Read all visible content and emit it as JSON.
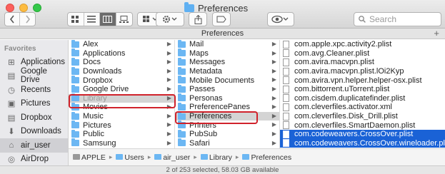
{
  "window": {
    "title": "Preferences",
    "path_title": "Preferences"
  },
  "toolbar": {
    "back_icon": "chevron-left-icon",
    "forward_icon": "chevron-right-icon",
    "view_modes": [
      "icon-view",
      "list-view",
      "column-view",
      "gallery-view"
    ],
    "active_view": "column-view",
    "search_placeholder": "Search"
  },
  "sidebar": {
    "heading": "Favorites",
    "items": [
      {
        "label": "Applications",
        "icon": "applications-icon"
      },
      {
        "label": "Google Drive",
        "icon": "drive-icon"
      },
      {
        "label": "Recents",
        "icon": "recents-icon"
      },
      {
        "label": "Pictures",
        "icon": "pictures-icon"
      },
      {
        "label": "Dropbox",
        "icon": "dropbox-icon"
      },
      {
        "label": "Downloads",
        "icon": "downloads-icon"
      },
      {
        "label": "air_user",
        "icon": "home-icon",
        "selected": true
      },
      {
        "label": "AirDrop",
        "icon": "airdrop-icon"
      }
    ]
  },
  "column1": [
    {
      "label": "Alex"
    },
    {
      "label": "Applications"
    },
    {
      "label": "Docs"
    },
    {
      "label": "Downloads"
    },
    {
      "label": "Dropbox"
    },
    {
      "label": "Google Drive"
    },
    {
      "label": "Library",
      "selected": true
    },
    {
      "label": "Movies"
    },
    {
      "label": "Music"
    },
    {
      "label": "Pictures"
    },
    {
      "label": "Public"
    },
    {
      "label": "Samsung"
    }
  ],
  "column2": [
    {
      "label": "Mail"
    },
    {
      "label": "Maps"
    },
    {
      "label": "Messages"
    },
    {
      "label": "Metadata"
    },
    {
      "label": "Mobile Documents"
    },
    {
      "label": "Passes"
    },
    {
      "label": "Personas"
    },
    {
      "label": "PreferencePanes"
    },
    {
      "label": "Preferences",
      "selected": true
    },
    {
      "label": "Printers"
    },
    {
      "label": "PubSub"
    },
    {
      "label": "Safari"
    }
  ],
  "column3": [
    {
      "label": "com.apple.xpc.activity2.plist"
    },
    {
      "label": "com.avg.Cleaner.plist"
    },
    {
      "label": "com.avira.macvpn.plist"
    },
    {
      "label": "com.avira.macvpn.plist.lOi2Kyp"
    },
    {
      "label": "com.avira.vpn.helper.helper-osx.plist"
    },
    {
      "label": "com.bittorrent.uTorrent.plist"
    },
    {
      "label": "com.cisdem.duplicatefinder.plist"
    },
    {
      "label": "com.cleverfiles.activator.xml"
    },
    {
      "label": "com.cleverfiles.Disk_Drill.plist"
    },
    {
      "label": "com.cleverfiles.SmartDaemon.plist"
    },
    {
      "label": "com.codeweavers.CrossOver.plist",
      "selected": true
    },
    {
      "label": "com.codeweavers.CrossOver.wineloader.plist",
      "selected": true
    }
  ],
  "pathbar": [
    "APPLE",
    "Users",
    "air_user",
    "Library",
    "Preferences"
  ],
  "status": "2 of 253 selected, 58.03 GB available",
  "colors": {
    "selection_blue": "#1a62d6",
    "highlight_red": "#d0222b",
    "folder_blue": "#6cb7f3"
  }
}
